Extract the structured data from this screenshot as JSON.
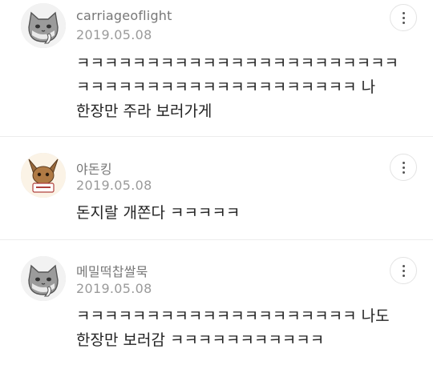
{
  "comments": [
    {
      "username": "carriageoflight",
      "date": "2019.05.08",
      "lines": [
        "ㅋㅋㅋㅋㅋㅋㅋㅋㅋㅋㅋㅋㅋㅋㅋㅋㅋㅋㅋㅋㅋㅋㅋ",
        "ㅋㅋㅋㅋㅋㅋㅋㅋㅋㅋㅋㅋㅋㅋㅋㅋㅋㅋㅋㅋ 나",
        "한장만 주라 보러가게"
      ],
      "avatar_icon": "gray-cat-avatar-icon"
    },
    {
      "username": "야돈킹",
      "date": "2019.05.08",
      "lines": [
        "돈지랄 개쫀다 ㅋㅋㅋㅋㅋ"
      ],
      "avatar_icon": "eevee-avatar-icon"
    },
    {
      "username": "메밀떡찹쌀묵",
      "date": "2019.05.08",
      "lines": [
        "ㅋㅋㅋㅋㅋㅋㅋㅋㅋㅋㅋㅋㅋㅋㅋㅋㅋㅋㅋㅋ 나도",
        "한장만 보러감 ㅋㅋㅋㅋㅋㅋㅋㅋㅋㅋㅋ"
      ],
      "avatar_icon": "gray-cat-avatar-icon"
    }
  ],
  "more_icon": "more-vertical-icon",
  "colors": {
    "username": "#777777",
    "date": "#9a9a9a",
    "text": "#222222",
    "divider": "#ececec"
  }
}
